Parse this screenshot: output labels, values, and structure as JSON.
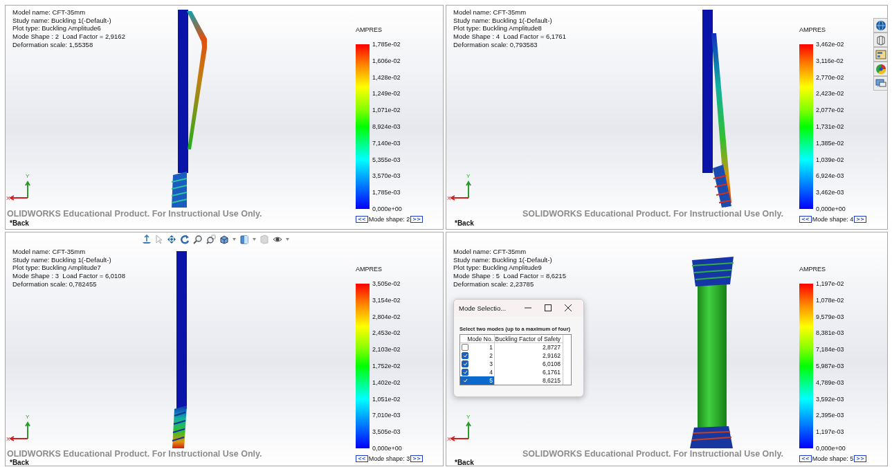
{
  "viewports": [
    {
      "info": [
        "Model name: CFT-35mm",
        "Study name: Buckling 1(-Default-)",
        "Plot type: Buckling Amplitude6",
        "Mode Shape : 2  Load Factor = 2,9162",
        "Deformation scale: 1,55358"
      ],
      "legend": {
        "title": "AMPRES",
        "ticks": [
          "1,785e-02",
          "1,606e-02",
          "1,428e-02",
          "1,249e-02",
          "1,071e-02",
          "8,924e-03",
          "7,140e-03",
          "5,355e-03",
          "3,570e-03",
          "1,785e-03",
          "0,000e+00"
        ]
      },
      "mode_nav": {
        "prev": "<<",
        "label": "Mode shape: 2",
        "next": ">>"
      },
      "banner": "OLIDWORKS Educational Product. For Instructional Use Only.",
      "back": "*Back",
      "triad": {
        "x": "X",
        "y": "Y"
      }
    },
    {
      "info": [
        "Model name: CFT-35mm",
        "Study name: Buckling 1(-Default-)",
        "Plot type: Buckling Amplitude8",
        "Mode Shape : 4  Load Factor = 6,1761",
        "Deformation scale: 0,793583"
      ],
      "legend": {
        "title": "AMPRES",
        "ticks": [
          "3,462e-02",
          "3,116e-02",
          "2,770e-02",
          "2,423e-02",
          "2,077e-02",
          "1,731e-02",
          "1,385e-02",
          "1,039e-02",
          "6,924e-03",
          "3,462e-03",
          "0,000e+00"
        ]
      },
      "mode_nav": {
        "prev": "<<",
        "label": "Mode shape: 4",
        "next": ">>"
      },
      "banner": "SOLIDWORKS Educational Product. For Instructional Use Only.",
      "back": "*Back",
      "triad": {
        "x": "X",
        "y": "Y"
      }
    },
    {
      "info": [
        "Model name: CFT-35mm",
        "Study name: Buckling 1(-Default-)",
        "Plot type: Buckling Amplitude7",
        "Mode Shape : 3  Load Factor = 6,0108",
        "Deformation scale: 0,782455"
      ],
      "legend": {
        "title": "AMPRES",
        "ticks": [
          "3,505e-02",
          "3,154e-02",
          "2,804e-02",
          "2,453e-02",
          "2,103e-02",
          "1,752e-02",
          "1,402e-02",
          "1,051e-02",
          "7,010e-03",
          "3,505e-03",
          "0,000e+00"
        ]
      },
      "mode_nav": {
        "prev": "<<",
        "label": "Mode shape: 3",
        "next": ">>"
      },
      "banner": "OLIDWORKS Educational Product. For Instructional Use Only.",
      "back": "*Back",
      "triad": {
        "x": "X",
        "y": "Y"
      }
    },
    {
      "info": [
        "Model name: CFT-35mm",
        "Study name: Buckling 1(-Default-)",
        "Plot type: Buckling Amplitude9",
        "Mode Shape : 5  Load Factor = 8,6215",
        "Deformation scale: 2,23785"
      ],
      "legend": {
        "title": "AMPRES",
        "ticks": [
          "1,197e-02",
          "1,078e-02",
          "9,579e-03",
          "8,381e-03",
          "7,184e-03",
          "5,987e-03",
          "4,789e-03",
          "3,592e-03",
          "2,395e-03",
          "1,197e-03",
          "0,000e+00"
        ]
      },
      "mode_nav": {
        "prev": "<<",
        "label": "Mode shape: 5",
        "next": ">>"
      },
      "banner": "SOLIDWORKS Educational Product. For Instructional Use Only.",
      "back": "*Back",
      "triad": {
        "x": "X",
        "y": "Y"
      },
      "dialog": {
        "title": "Mode Selectio...",
        "instruction": "Select two modes (up to a maximum of four)",
        "columns": [
          "Mode No.",
          "Buckling Factor of Safety"
        ],
        "rows": [
          {
            "mode": "1",
            "factor": "2,8727",
            "checked": false,
            "selected": false
          },
          {
            "mode": "2",
            "factor": "2,9162",
            "checked": true,
            "selected": false
          },
          {
            "mode": "3",
            "factor": "6,0108",
            "checked": true,
            "selected": false
          },
          {
            "mode": "4",
            "factor": "6,1761",
            "checked": true,
            "selected": false
          },
          {
            "mode": "5",
            "factor": "8,6215",
            "checked": true,
            "selected": true
          }
        ]
      }
    }
  ]
}
